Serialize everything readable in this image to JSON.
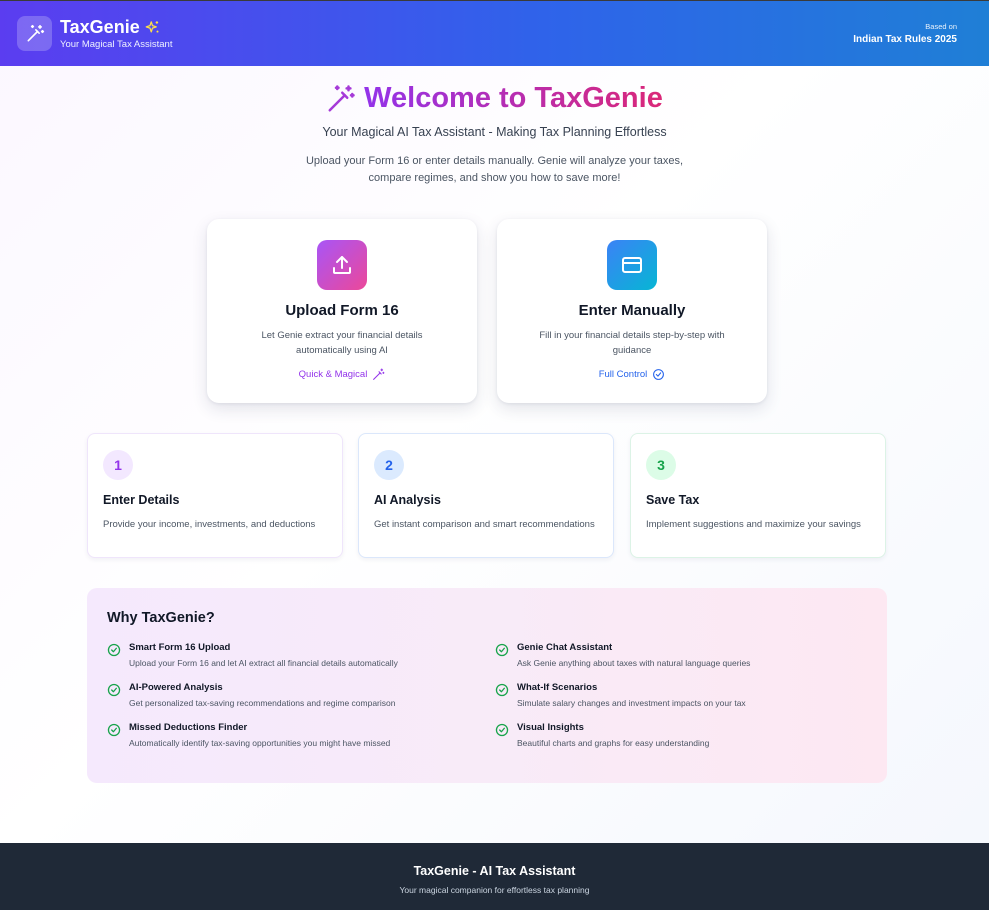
{
  "header": {
    "app_name": "TaxGenie",
    "tagline": "Your Magical Tax Assistant",
    "based_on_label": "Based on",
    "rules_label": "Indian Tax Rules 2025",
    "logo_icon": "magic-wand-icon",
    "sparkle_icon": "sparkles-icon",
    "gradient": [
      "#5b3df0",
      "#2f63ea",
      "#1f7fd6"
    ]
  },
  "hero": {
    "title": "Welcome to TaxGenie",
    "subtitle": "Your Magical AI Tax Assistant - Making Tax Planning Effortless",
    "description": "Upload your Form 16 or enter details manually. Genie will analyze your taxes, compare regimes, and show you how to save more!",
    "title_colors": [
      "#9333ea",
      "#db2777"
    ]
  },
  "options": {
    "upload": {
      "title": "Upload Form 16",
      "description": "Let Genie extract your financial details automatically using AI",
      "link": "Quick & Magical",
      "icon": "upload-icon",
      "link_icon": "magic-wand-icon",
      "accent": "#9333ea"
    },
    "manual": {
      "title": "Enter Manually",
      "description": "Fill in your financial details step-by-step with guidance",
      "link": "Full Control",
      "icon": "credit-card-icon",
      "link_icon": "check-circle-icon",
      "accent": "#2563eb"
    }
  },
  "steps": [
    {
      "number": "1",
      "title": "Enter Details",
      "description": "Provide your income, investments, and deductions",
      "color": "#9333ea"
    },
    {
      "number": "2",
      "title": "AI Analysis",
      "description": "Get instant comparison and smart recommendations",
      "color": "#2563eb"
    },
    {
      "number": "3",
      "title": "Save Tax",
      "description": "Implement suggestions and maximize your savings",
      "color": "#16a34a"
    }
  ],
  "why": {
    "title": "Why TaxGenie?",
    "check_color": "#16a34a",
    "features": [
      {
        "title": "Smart Form 16 Upload",
        "description": "Upload your Form 16 and let AI extract all financial details automatically"
      },
      {
        "title": "Genie Chat Assistant",
        "description": "Ask Genie anything about taxes with natural language queries"
      },
      {
        "title": "AI-Powered Analysis",
        "description": "Get personalized tax-saving recommendations and regime comparison"
      },
      {
        "title": "What-If Scenarios",
        "description": "Simulate salary changes and investment impacts on your tax"
      },
      {
        "title": "Missed Deductions Finder",
        "description": "Automatically identify tax-saving opportunities you might have missed"
      },
      {
        "title": "Visual Insights",
        "description": "Beautiful charts and graphs for easy understanding"
      }
    ]
  },
  "footer": {
    "title": "TaxGenie - AI Tax Assistant",
    "subtitle": "Your magical companion for effortless tax planning",
    "background": "#1f2937"
  }
}
